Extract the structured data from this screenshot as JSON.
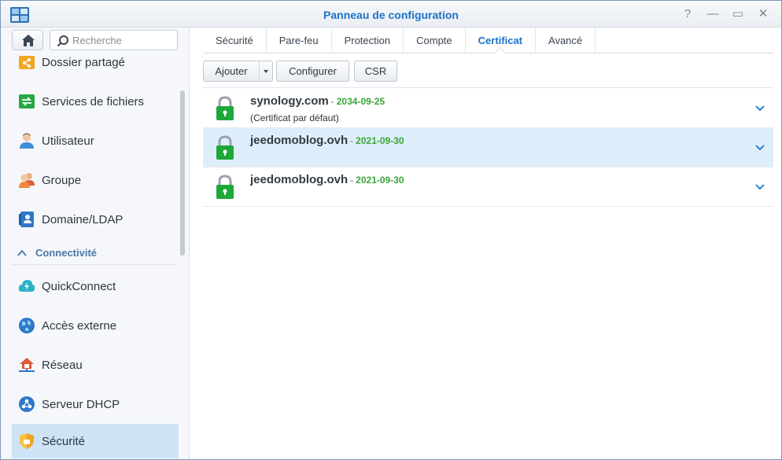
{
  "window": {
    "title": "Panneau de configuration",
    "controls": [
      "?",
      "—",
      "▭",
      "✕"
    ]
  },
  "sidebar": {
    "search_placeholder": "Recherche",
    "items_top": [
      {
        "label": "Dossier partagé",
        "icon": "shared-folder-icon"
      },
      {
        "label": "Services de fichiers",
        "icon": "file-services-icon"
      },
      {
        "label": "Utilisateur",
        "icon": "user-icon"
      },
      {
        "label": "Groupe",
        "icon": "group-icon"
      },
      {
        "label": "Domaine/LDAP",
        "icon": "domain-ldap-icon"
      }
    ],
    "section": {
      "label": "Connectivité"
    },
    "items_conn": [
      {
        "label": "QuickConnect",
        "icon": "quickconnect-icon"
      },
      {
        "label": "Accès externe",
        "icon": "globe-icon"
      },
      {
        "label": "Réseau",
        "icon": "network-icon"
      },
      {
        "label": "Serveur DHCP",
        "icon": "dhcp-icon"
      },
      {
        "label": "Sécurité",
        "icon": "shield-icon",
        "active": true
      }
    ]
  },
  "tabs": [
    {
      "label": "Sécurité"
    },
    {
      "label": "Pare-feu"
    },
    {
      "label": "Protection"
    },
    {
      "label": "Compte"
    },
    {
      "label": "Certificat",
      "active": true
    },
    {
      "label": "Avancé"
    }
  ],
  "toolbar": {
    "add_label": "Ajouter",
    "configure_label": "Configurer",
    "csr_label": "CSR"
  },
  "certificates": [
    {
      "name": "synology.com",
      "separator": "-",
      "date": "2034-09-25",
      "note": "(Certificat par défaut)"
    },
    {
      "name": "jeedomoblog.ovh",
      "separator": "-",
      "date": "2021-09-30",
      "note": "",
      "selected": true
    },
    {
      "name": "jeedomoblog.ovh",
      "separator": "-",
      "date": "2021-09-30",
      "note": ""
    }
  ],
  "colors": {
    "accent": "#1a73c8",
    "date_green": "#3aa538",
    "lock_green": "#1fa83a",
    "selection": "#ddeefa"
  }
}
